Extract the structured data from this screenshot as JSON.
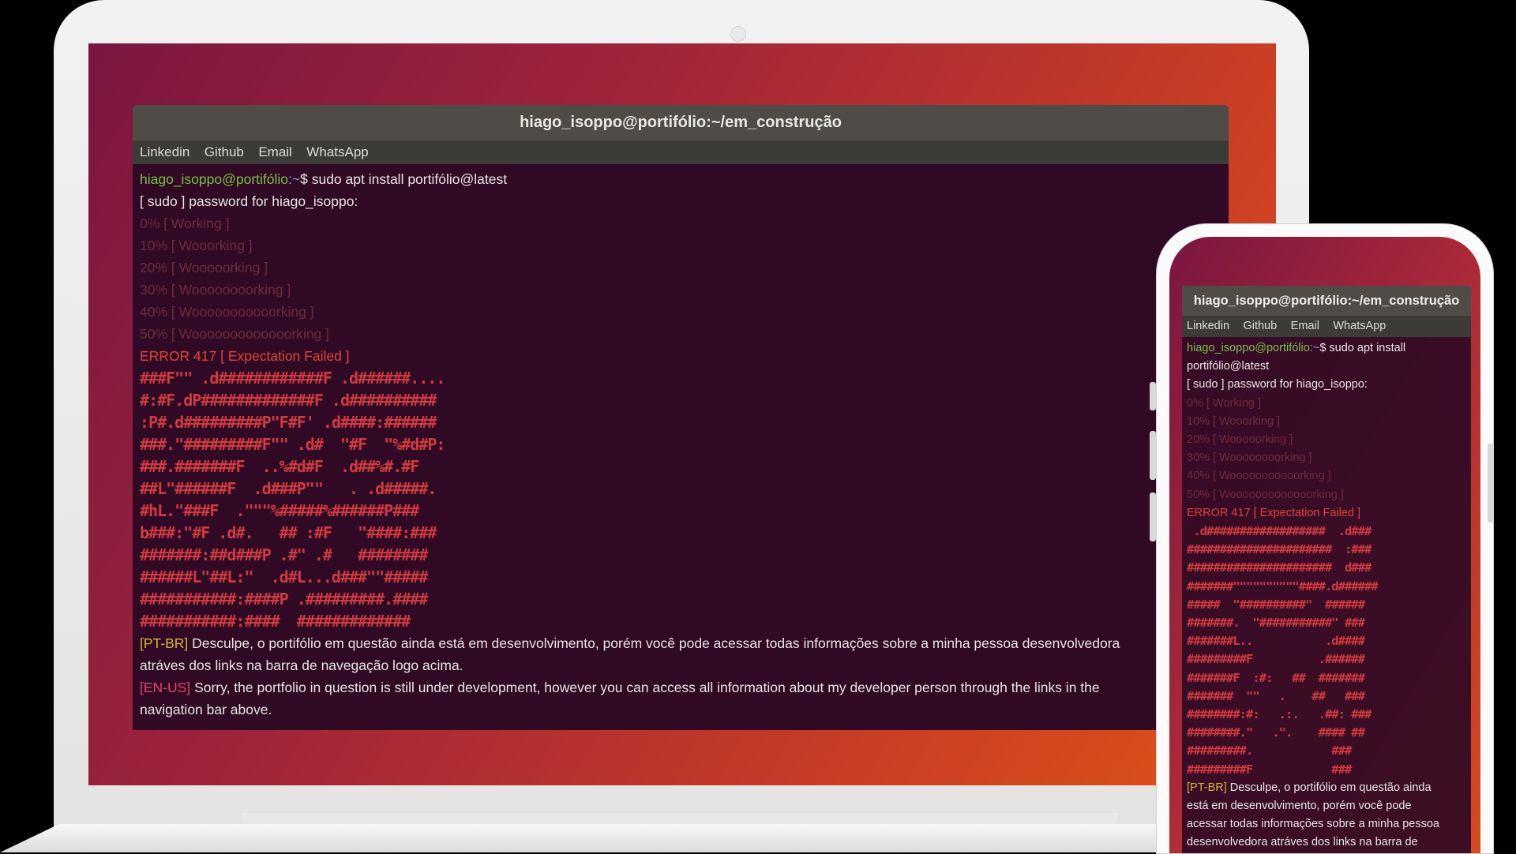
{
  "window_title": "hiago_isoppo@portifólio:~/em_construção",
  "nav": [
    "Linkedin",
    "Github",
    "Email",
    "WhatsApp"
  ],
  "prompt": {
    "user": "hiago_isoppo@portifólio",
    "path": ":~",
    "symbol": "$",
    "command": " sudo apt install portifólio@latest"
  },
  "sudo_line": "[ sudo ] password for hiago_isoppo:",
  "progress": [
    "0% [ Working ]",
    "10% [ Wooorking ]",
    "20% [ Wooooorking ]",
    "30% [ Woooooooorking ]",
    "40% [ Wooooooooooorking ]",
    "50% [ Wooooooooooooorking ]"
  ],
  "error": "ERROR 417 [ Expectation Failed ]",
  "ascii_art_laptop": "###F\"\" .d############F .d######....\n#:#F.dP#############F .d##########\n:P#.d#########P\"F#F' .d####:######\n###.\"#########F\"\" .d#  \"#F  \"%#d#P:\n###.#######F  ..%#d#F  .d##%#.#F\n##L\"######F  .d###P\"\"   . .d#####.\n#hL.\"###F  .\"\"\"%#####%######P###\nb###:\"#F .d#.   ## :#F   \"####:###\n#######:##d###P .#\" .#   ########\n######L\"##L:\"  .d#L...d###\"\"#####\n###########:####P .#########.####\n###########:####  #############",
  "ascii_art_phone": " .d##################  .d###\n######################  :###\n######################  d###\n#######\"\"\"\"\"\"\"\"\"\"####.d######\n#####  \"##########\"  ######\n#######.  \"###########\" ###\n#######L..           .d####\n#########F          .######\n#######F  :#:   ##  #######\n#######  \"\"   .    ##   ###\n########:#:   .:.   .##: ###\n########.\"   .\".    #### ##\n#########.            ### \n#########F            ###",
  "messages": {
    "br_tag": "[PT-BR]",
    "br_text": "Desculpe, o portifólio em questão ainda está em desenvolvimento, porém você pode acessar todas informações sobre a minha pessoa desenvolvedora",
    "br_text_2": "atráves dos links na barra de navegação logo acima.",
    "us_tag": "[EN-US]",
    "us_text": "Sorry, the portfolio in question is still under development, however you can access all information about my developer person through the links in the",
    "us_text_2": "navigation bar above."
  },
  "phone": {
    "command_l1": " sudo apt install",
    "command_l2": "portifólio@latest",
    "br_text_1": "Desculpe, o portifólio em questão ainda",
    "br_text_2": "está em desenvolvimento, porém você pode",
    "br_text_3": "acessar todas informações sobre a minha pessoa",
    "br_text_4": "desenvolvedora atráves dos links na barra de"
  }
}
